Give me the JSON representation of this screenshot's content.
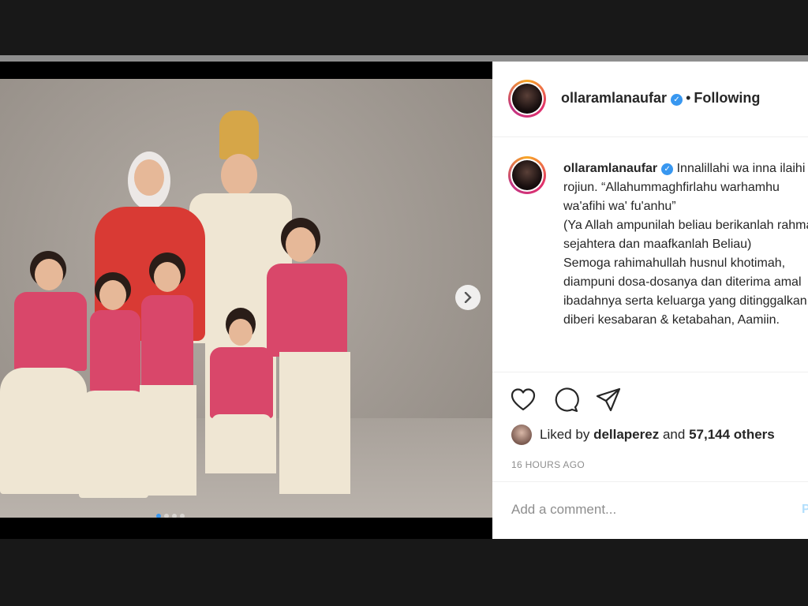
{
  "account": {
    "username": "ollaramlanaufar",
    "separator": "•",
    "follow_status": "Following"
  },
  "caption": {
    "username": "ollaramlanaufar",
    "lines": [
      "Innalillahi wa inna ilaihi rojiun. “Allahummaghfirlahu warhamhu wa'afihi wa' fu'anhu”",
      "(Ya Allah ampunilah beliau berikanlah rahmat, sejahtera dan maafkanlah Beliau)",
      "Semoga rahimahullah husnul khotimah, diampuni dosa-dosanya dan diterima amal ibadahnya serta keluarga yang ditinggalkan diberi kesabaran & ketabahan, Aamiin."
    ]
  },
  "likes": {
    "prefix": "Liked by",
    "user": "dellaperez",
    "connector": "and",
    "others": "57,144 others"
  },
  "timestamp": "16 HOURS AGO",
  "comment": {
    "placeholder": "Add a comment...",
    "post_label": "P"
  },
  "carousel": {
    "next_icon": "chevron-right-icon",
    "slide_count": 4,
    "active_index": 0
  },
  "colors": {
    "verified": "#3897f0",
    "story_ring": "#e1306c",
    "active_dot": "#3897f0"
  }
}
